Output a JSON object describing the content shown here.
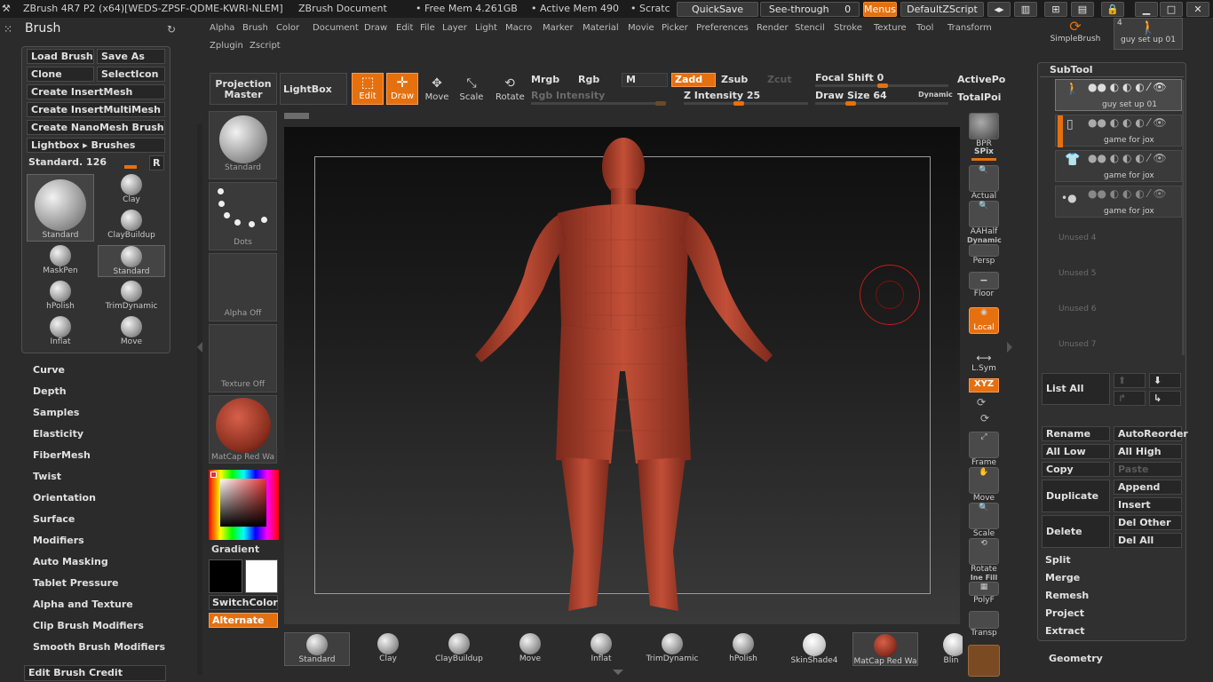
{
  "titlebar": {
    "app": "ZBrush 4R7 P2 (x64)[WEDS-ZPSF-QDME-KWRI-NLEM]",
    "doc": "ZBrush Document",
    "free_mem": "• Free Mem 4.261GB",
    "active_mem": "• Active Mem 490",
    "scratch": "• Scratc",
    "quicksave": "QuickSave",
    "see_through": "See-through",
    "see_through_value": "0",
    "menus": "Menus",
    "script": "DefaultZScript"
  },
  "menubar": {
    "row1": [
      "Alpha",
      "Brush",
      "Color",
      "Document",
      "Draw",
      "Edit",
      "File",
      "Layer",
      "Light",
      "Macro",
      "Marker",
      "Material",
      "Movie",
      "Picker",
      "Preferences",
      "Render",
      "Stencil",
      "Stroke",
      "Texture",
      "Tool",
      "Transform"
    ],
    "row2": [
      "Zplugin",
      "Zscript"
    ]
  },
  "brush_palette": {
    "title": "Brush",
    "buttons": [
      "Load Brush",
      "Save As",
      "Clone",
      "SelectIcon",
      "Create InsertMesh",
      "Create InsertMultiMesh",
      "Create NanoMesh Brush",
      "Lightbox ▸ Brushes"
    ],
    "standard_label": "Standard. 126",
    "r_button": "R",
    "brushes": [
      "Standard",
      "Clay",
      "ClayBuildup",
      "MaskPen",
      "Standard",
      "hPolish",
      "TrimDynamic",
      "Inflat",
      "Move"
    ],
    "sections": [
      "Curve",
      "Depth",
      "Samples",
      "Elasticity",
      "FiberMesh",
      "Twist",
      "Orientation",
      "Surface",
      "Modifiers",
      "Auto Masking",
      "Tablet Pressure",
      "Alpha and Texture",
      "Clip Brush Modifiers",
      "Smooth Brush Modifiers"
    ],
    "edit_credit": "Edit Brush Credit"
  },
  "toolbar": {
    "projection_master": "Projection Master",
    "lightbox": "LightBox",
    "edit": "Edit",
    "draw": "Draw",
    "move": "Move",
    "scale": "Scale",
    "rotate": "Rotate",
    "mrgb": "Mrgb",
    "rgb": "Rgb",
    "m": "M",
    "rgb_intensity": "Rgb Intensity",
    "zadd": "Zadd",
    "zsub": "Zsub",
    "zcut": "Zcut",
    "z_intensity": "Z Intensity 25",
    "focal_shift": "Focal Shift 0",
    "draw_size": "Draw Size 64",
    "dynamic": "Dynamic",
    "active_points": "ActivePo",
    "total_points": "TotalPoi"
  },
  "left_column": {
    "brush_thumb": "Standard",
    "stroke_thumb": "Dots",
    "alpha_thumb": "Alpha Off",
    "texture_thumb": "Texture Off",
    "material_thumb": "MatCap Red Wa",
    "gradient": "Gradient",
    "switch_color": "SwitchColor",
    "alternate": "Alternate"
  },
  "right_shelf": [
    "BPR",
    "SPix",
    "Actual",
    "AAHalf",
    "Persp",
    "Floor",
    "Local",
    "L.Sym",
    "XYZ",
    "Frame",
    "Move",
    "Scale",
    "Rotate",
    "PolyF",
    "Transp"
  ],
  "right_shelf_labels": {
    "dynamic": "Dynamic",
    "line_fill": "Ine Fill"
  },
  "bottom_strip": [
    "Standard",
    "Clay",
    "ClayBuildup",
    "Move",
    "Inflat",
    "TrimDynamic",
    "hPolish",
    "SkinShade4",
    "MatCap Red Wa",
    "Blin"
  ],
  "subtool": {
    "top_tools": [
      "SimpleBrush",
      "guy set up 01"
    ],
    "top_count": "4",
    "title": "SubTool",
    "items": [
      "guy set up 01",
      "game for jox",
      "game for jox",
      "game for jox"
    ],
    "unused": [
      "Unused 4",
      "Unused 5",
      "Unused 6",
      "Unused 7"
    ],
    "list_all": "List All",
    "buttons": [
      "Rename",
      "AutoReorder",
      "All Low",
      "All High",
      "Copy",
      "Paste",
      "Duplicate",
      "Append",
      "Insert",
      "Delete",
      "Del Other",
      "Del All"
    ],
    "sections": [
      "Split",
      "Merge",
      "Remesh",
      "Project",
      "Extract"
    ],
    "geometry": "Geometry"
  },
  "colors": {
    "accent": "#e5700f",
    "bg": "#2b2b2b",
    "model": "#b8432e"
  }
}
